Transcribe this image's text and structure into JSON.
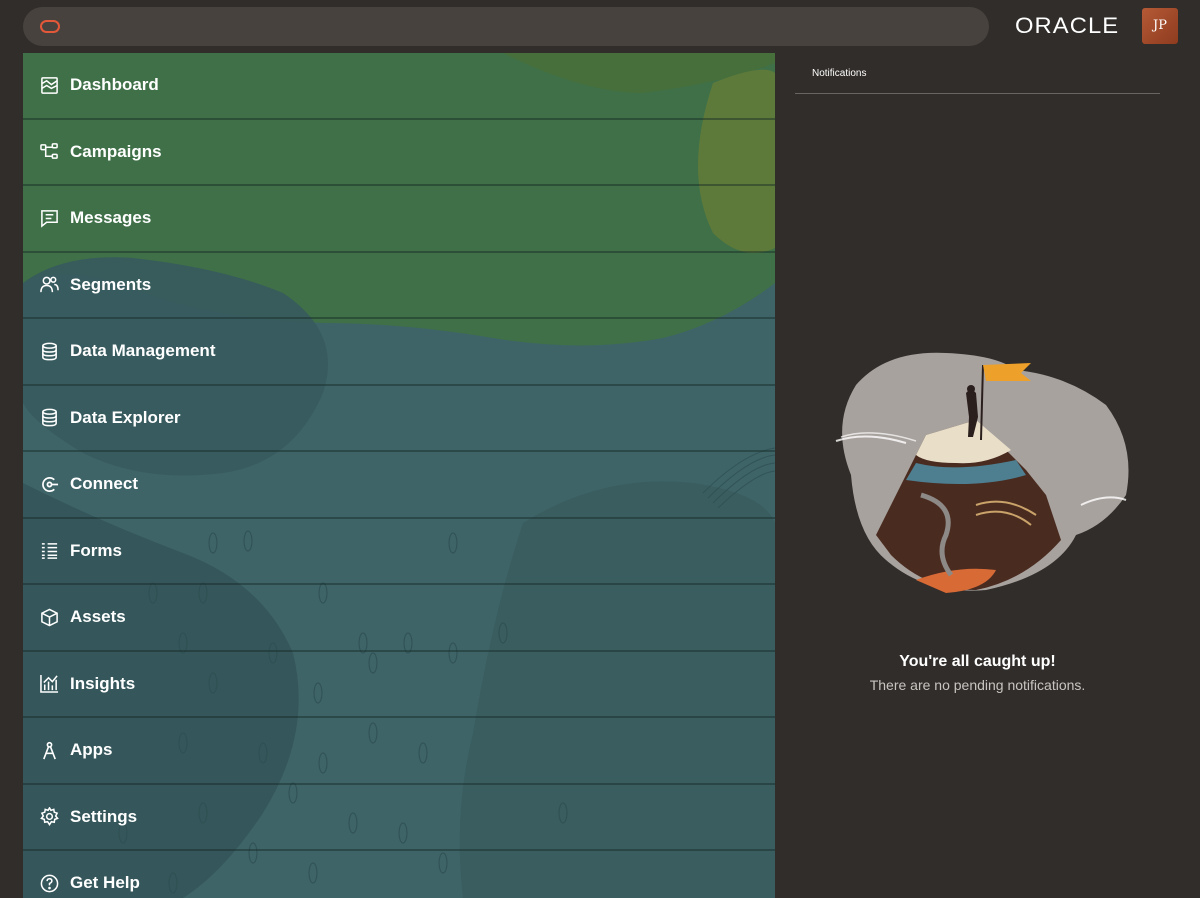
{
  "app": {
    "brand": "ORACLE",
    "avatar_initials": "JP",
    "accent_color": "#e4583a"
  },
  "nav": {
    "items": [
      {
        "label": "Dashboard",
        "icon": "dashboard-icon"
      },
      {
        "label": "Campaigns",
        "icon": "campaigns-icon"
      },
      {
        "label": "Messages",
        "icon": "messages-icon"
      },
      {
        "label": "Segments",
        "icon": "segments-icon"
      },
      {
        "label": "Data Management",
        "icon": "database-icon"
      },
      {
        "label": "Data Explorer",
        "icon": "database-icon"
      },
      {
        "label": "Connect",
        "icon": "connect-icon"
      },
      {
        "label": "Forms",
        "icon": "forms-icon"
      },
      {
        "label": "Assets",
        "icon": "cube-icon"
      },
      {
        "label": "Insights",
        "icon": "chart-icon"
      },
      {
        "label": "Apps",
        "icon": "compass-icon"
      },
      {
        "label": "Settings",
        "icon": "gear-icon"
      },
      {
        "label": "Get Help",
        "icon": "help-icon"
      }
    ]
  },
  "notifications": {
    "title": "Notifications",
    "empty_title": "You're all caught up!",
    "empty_message": "There are no pending notifications."
  }
}
